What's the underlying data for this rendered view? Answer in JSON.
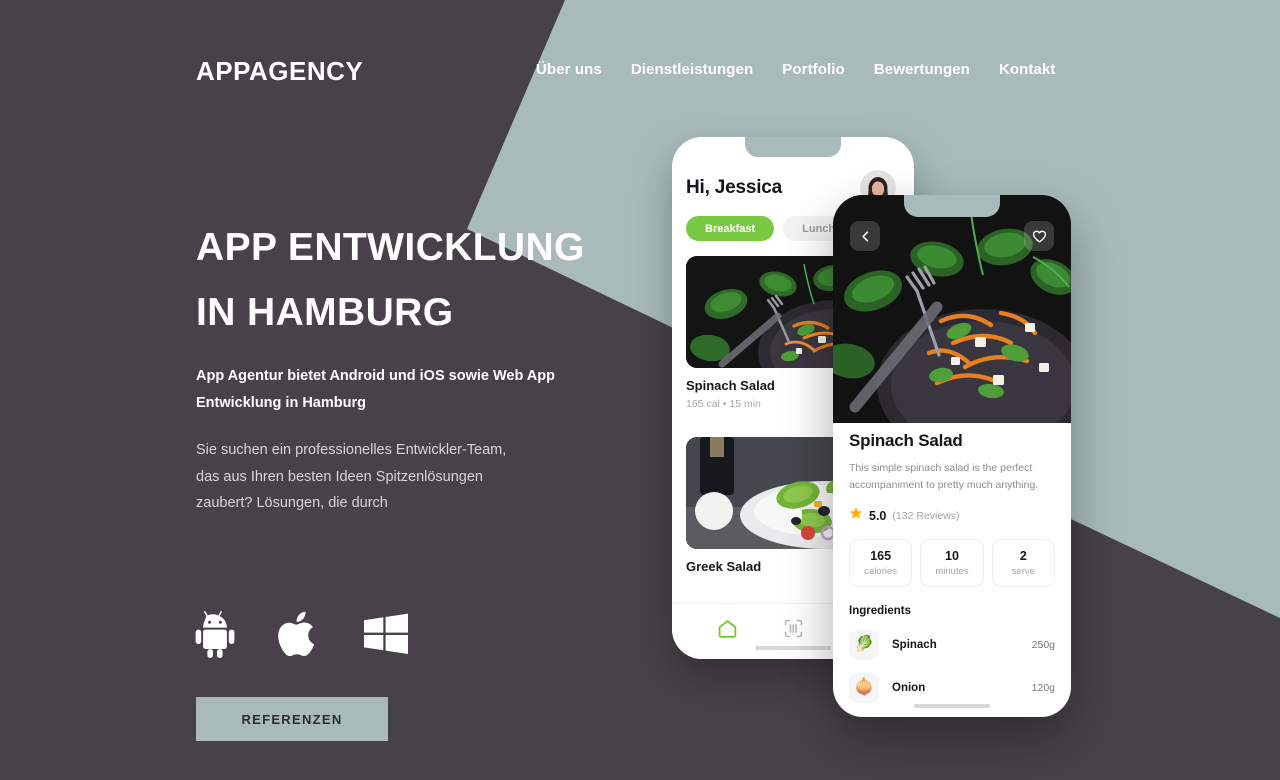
{
  "colors": {
    "dark_bg": "#474247",
    "sage": "#a8bbba",
    "accent_green": "#7ac943",
    "star_yellow": "#fcb415",
    "white": "#ffffff"
  },
  "header": {
    "logo": "APPAGENCY",
    "nav": [
      {
        "label": "Über uns"
      },
      {
        "label": "Dienstleistungen"
      },
      {
        "label": "Portfolio"
      },
      {
        "label": "Bewertungen"
      },
      {
        "label": "Kontakt"
      }
    ]
  },
  "hero": {
    "title": "APP ENTWICKLUNG IN HAMBURG",
    "subtitle": "App Agentur bietet Android und iOS sowie Web App Entwicklung in Hamburg",
    "body": "Sie suchen ein professionelles Entwickler-Team, das aus Ihren besten Ideen Spitzenlösungen zaubert? Lösungen, die durch",
    "platforms": [
      {
        "name": "android-icon"
      },
      {
        "name": "apple-icon"
      },
      {
        "name": "windows-icon"
      }
    ],
    "cta_label": "REFERENZEN"
  },
  "phone_back": {
    "greeting": "Hi, Jessica",
    "avatar_name": "user-avatar",
    "chips": [
      {
        "label": "Breakfast",
        "active": true
      },
      {
        "label": "Lunch",
        "active": false
      }
    ],
    "cards": [
      {
        "name": "Spinach Salad",
        "meta": "165 cal  •  15 min"
      },
      {
        "name": "Greek Salad",
        "meta": ""
      }
    ],
    "tabs": [
      {
        "name": "home-icon",
        "active": true
      },
      {
        "name": "scan-icon",
        "active": false
      },
      {
        "name": "search-icon",
        "active": false
      }
    ]
  },
  "phone_front": {
    "back_icon": "chevron-left-icon",
    "favorite_icon": "heart-icon",
    "title": "Spinach Salad",
    "description": "This simple spinach salad is the perfect accompaniment to pretty much anything.",
    "rating_icon": "star-icon",
    "rating_value": "5.0",
    "rating_count": "(132 Reviews)",
    "stats": [
      {
        "value": "165",
        "label": "calories"
      },
      {
        "value": "10",
        "label": "minutes"
      },
      {
        "value": "2",
        "label": "serve"
      }
    ],
    "ingredients_heading": "Ingredients",
    "ingredients": [
      {
        "icon": "🥬",
        "name": "Spinach",
        "amount": "250g"
      },
      {
        "icon": "🧅",
        "name": "Onion",
        "amount": "120g"
      }
    ]
  }
}
